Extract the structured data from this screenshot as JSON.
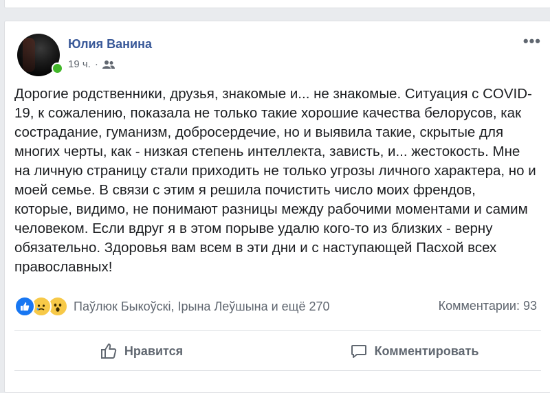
{
  "post": {
    "author": "Юлия Ванина",
    "time": "19 ч.",
    "separator": "·",
    "audience_icon": "friends-icon",
    "more_label": "•••",
    "text": "Дорогие родственники, друзья, знакомые и... не знакомые. Ситуация с COVID-19, к сожалению, показала не только такие хорошие качества белорусов, как сострадание, гуманизм, добросердечие, но и выявила такие, скрытые для многих черты, как - низкая степень интеллекта, зависть, и... жестокость. Мне на личную страницу стали приходить не только угрозы личного характера, но и моей семье. В связи с этим я решила почистить число моих френдов, которые, видимо, не понимают разницы между рабочими моментами и самим человеком. Если вдруг я в этом порыве удалю кого-то из близких - верну обязательно. Здоровья вам всем в эти дни и с наступающей Пасхой всех православных!"
  },
  "reactions": {
    "icons": [
      "like-icon",
      "sad-icon",
      "wow-icon"
    ],
    "summary": "Паўлюк Быкоўскі, Ірына Леўшына и ещё 270",
    "comments": "Комментарии: 93"
  },
  "actions": {
    "like_label": "Нравится",
    "comment_label": "Комментировать"
  },
  "colors": {
    "author_link": "#385898",
    "like_blue": "#1877f2",
    "online_green": "#42b72a",
    "secondary_text": "#606770"
  }
}
